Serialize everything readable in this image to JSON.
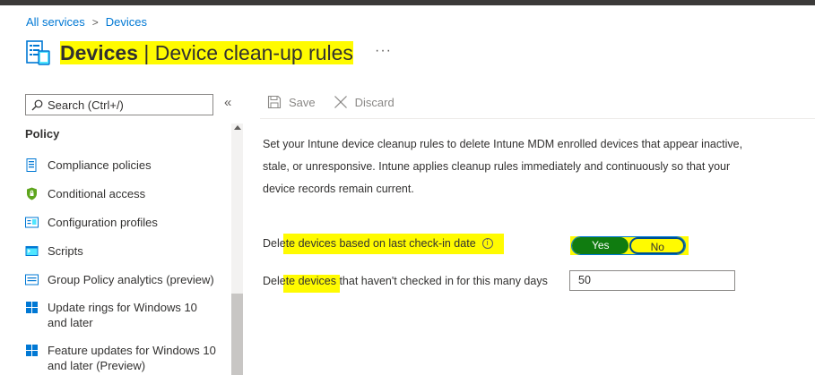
{
  "breadcrumb": {
    "items": [
      "All services",
      "Devices"
    ],
    "separator": ">"
  },
  "header": {
    "title_main": "Devices",
    "title_sep": " | ",
    "title_sub": "Device clean-up rules",
    "more": "···"
  },
  "sidebar": {
    "search_placeholder": "Search (Ctrl+/)",
    "collapse": "«",
    "section": "Policy",
    "items": [
      {
        "label": "Compliance policies",
        "icon": "compliance-icon"
      },
      {
        "label": "Conditional access",
        "icon": "shield-icon"
      },
      {
        "label": "Configuration profiles",
        "icon": "configuration-icon"
      },
      {
        "label": "Scripts",
        "icon": "scripts-icon"
      },
      {
        "label": "Group Policy analytics (preview)",
        "icon": "group-policy-icon"
      },
      {
        "label": "Update rings for Windows 10 and later",
        "icon": "windows-icon"
      },
      {
        "label": "Feature updates for Windows 10 and later (Preview)",
        "icon": "windows-icon"
      }
    ]
  },
  "toolbar": {
    "save": "Save",
    "discard": "Discard"
  },
  "content": {
    "description": "Set your Intune device cleanup rules to delete Intune MDM enrolled devices that appear inactive, stale, or unresponsive. Intune applies cleanup rules immediately and continuously so that your device records remain current.",
    "delete_label": "Delete devices based on last check-in date",
    "toggle": {
      "yes": "Yes",
      "no": "No",
      "selected": "Yes"
    },
    "days_label": "Delete devices that haven't checked in for this many days",
    "days_value": "50"
  },
  "colors": {
    "accent": "#0078d4",
    "highlight": "#fffb00",
    "toggle_on": "#107c10"
  }
}
